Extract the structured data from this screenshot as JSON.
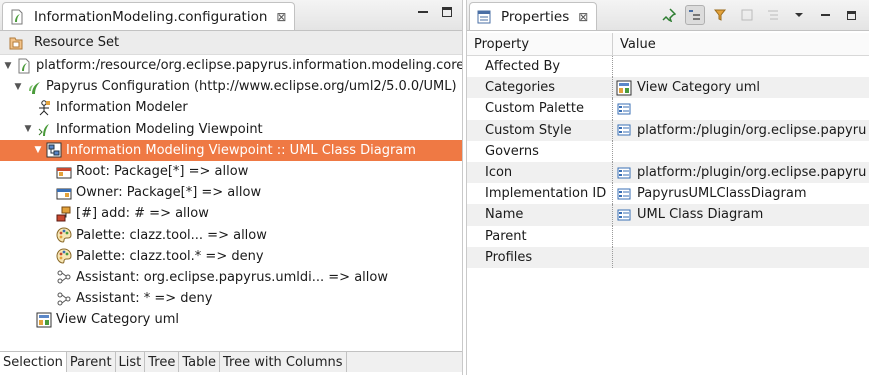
{
  "editor": {
    "tab_title": "InformationModeling.configuration",
    "resource_header": "Resource Set",
    "tree": [
      {
        "label": "platform:/resource/org.eclipse.papyrus.information.modeling.core,",
        "depth": 0,
        "expanded": true,
        "icon": "resource-file-icon"
      },
      {
        "label": "Papyrus Configuration (http://www.eclipse.org/uml2/5.0.0/UML)",
        "depth": 1,
        "expanded": true,
        "icon": "configuration-icon"
      },
      {
        "label": "Information Modeler",
        "depth": 2,
        "expanded": null,
        "icon": "stakeholder-icon"
      },
      {
        "label": "Information Modeling Viewpoint",
        "depth": 2,
        "expanded": true,
        "icon": "viewpoint-icon"
      },
      {
        "label": "Information Modeling Viewpoint :: UML Class Diagram",
        "depth": 3,
        "expanded": true,
        "icon": "diagram-kind-icon",
        "selected": true
      },
      {
        "label": "Root: Package[*] => allow",
        "depth": 4,
        "expanded": null,
        "icon": "root-rule-icon"
      },
      {
        "label": "Owner: Package[*] => allow",
        "depth": 4,
        "expanded": null,
        "icon": "owner-rule-icon"
      },
      {
        "label": "[#] add: # => allow",
        "depth": 4,
        "expanded": null,
        "icon": "child-rule-icon"
      },
      {
        "label": "Palette: clazz.tool... => allow",
        "depth": 4,
        "expanded": null,
        "icon": "palette-rule-icon"
      },
      {
        "label": "Palette: clazz.tool.* => deny",
        "depth": 4,
        "expanded": null,
        "icon": "palette-rule-icon"
      },
      {
        "label": "Assistant: org.eclipse.papyrus.umldi... => allow",
        "depth": 4,
        "expanded": null,
        "icon": "assistant-rule-icon"
      },
      {
        "label": "Assistant: * => deny",
        "depth": 4,
        "expanded": null,
        "icon": "assistant-rule-icon"
      },
      {
        "label": "View Category uml",
        "depth": 2,
        "expanded": null,
        "icon": "category-icon"
      }
    ],
    "bottom_tabs": [
      "Selection",
      "Parent",
      "List",
      "Tree",
      "Table",
      "Tree with Columns"
    ]
  },
  "properties": {
    "tab_title": "Properties",
    "col_property": "Property",
    "col_value": "Value",
    "rows": [
      {
        "name": "Affected By",
        "value": "",
        "icon": ""
      },
      {
        "name": "Categories",
        "value": "View Category uml",
        "icon": "category-icon"
      },
      {
        "name": "Custom Palette",
        "value": "",
        "icon": "item-icon"
      },
      {
        "name": "Custom Style",
        "value": "platform:/plugin/org.eclipse.papyru",
        "icon": "item-icon"
      },
      {
        "name": "Governs",
        "value": "",
        "icon": ""
      },
      {
        "name": "Icon",
        "value": "platform:/plugin/org.eclipse.papyru",
        "icon": "item-icon"
      },
      {
        "name": "Implementation ID",
        "value": "PapyrusUMLClassDiagram",
        "icon": "item-icon"
      },
      {
        "name": "Name",
        "value": "UML Class Diagram",
        "icon": "item-icon"
      },
      {
        "name": "Parent",
        "value": "",
        "icon": ""
      },
      {
        "name": "Profiles",
        "value": "",
        "icon": ""
      }
    ]
  },
  "colors": {
    "selection": "#ef7944",
    "header_bg": "#ececec",
    "alt_row": "#f0f0f0"
  }
}
